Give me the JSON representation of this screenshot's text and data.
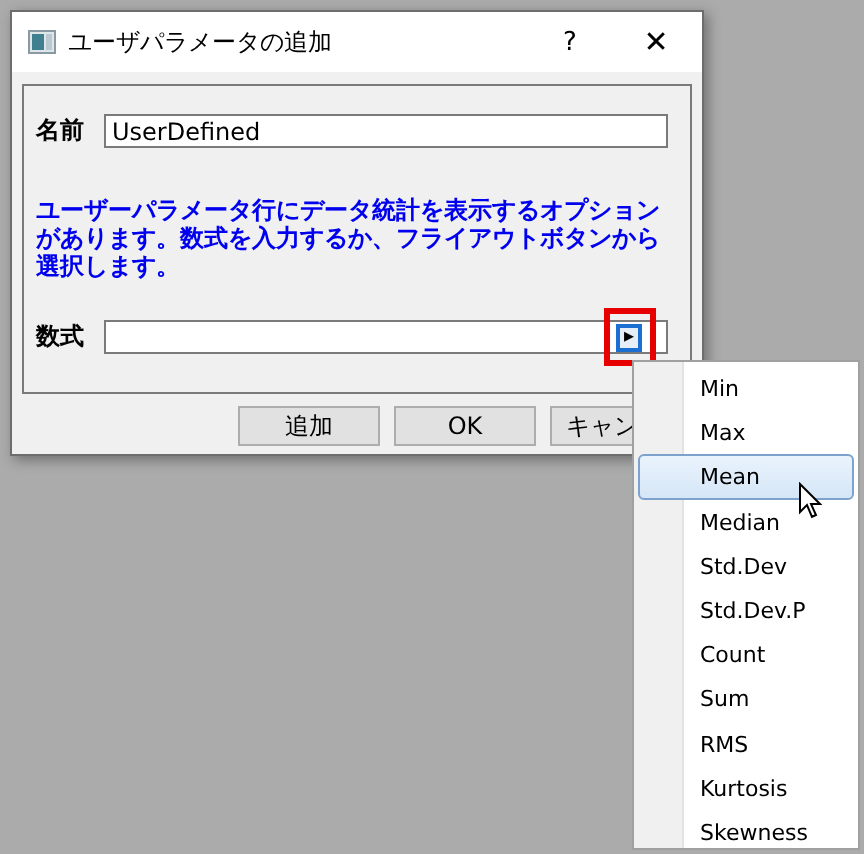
{
  "window": {
    "title": "ユーザパラメータの追加",
    "help": "?",
    "close": "✕"
  },
  "name_field": {
    "label": "名前",
    "value": "UserDefined"
  },
  "hint": "ユーザーパラメータ行にデータ統計を表示するオプションがあります。数式を入力するか、フライアウトボタンから選択します。",
  "formula_field": {
    "label": "数式",
    "flyout": "▸",
    "highlighted": true
  },
  "buttons": [
    "追加",
    "OK",
    "キャン"
  ],
  "menu": {
    "items": [
      {
        "label": "Min",
        "selected": false
      },
      {
        "label": "Max",
        "selected": false
      },
      {
        "label": "Mean",
        "selected": true
      },
      {
        "label": "Median",
        "selected": false
      },
      {
        "label": "Std.Dev",
        "selected": false
      },
      {
        "label": "Std.Dev.P",
        "selected": false
      },
      {
        "label": "Count",
        "selected": false
      },
      {
        "label": "Sum",
        "selected": false
      },
      {
        "label": "RMS",
        "selected": false
      },
      {
        "label": "Kurtosis",
        "selected": false
      },
      {
        "label": "Skewness",
        "selected": false
      }
    ]
  }
}
